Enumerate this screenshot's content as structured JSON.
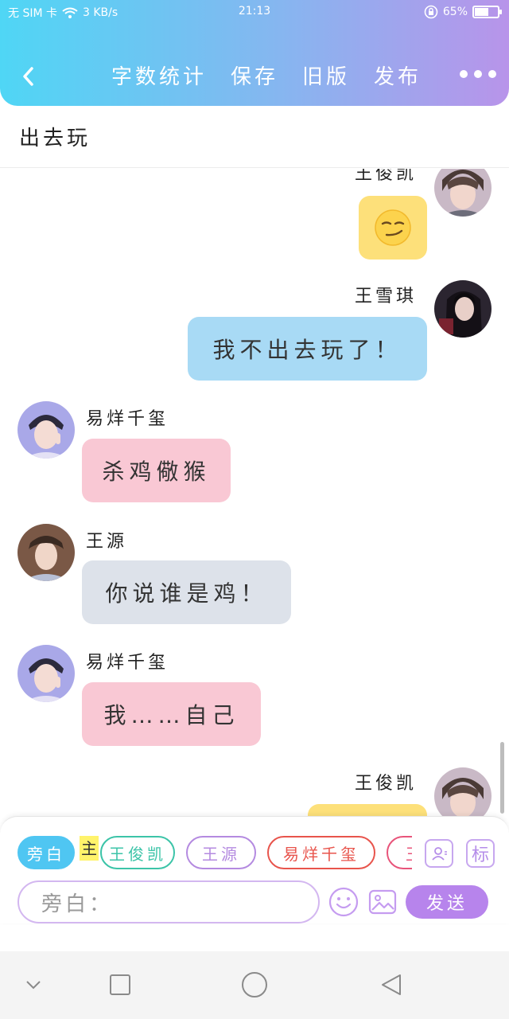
{
  "status_bar": {
    "carrier": "无 SIM 卡",
    "speed": "3 KB/s",
    "time": "21:13",
    "battery_text": "65%",
    "battery_level": 0.65
  },
  "nav": {
    "actions": [
      "字数统计",
      "保存",
      "旧版",
      "发布"
    ],
    "back_icon": "back-arrow-icon",
    "more_icon": "more-dots-icon"
  },
  "title": "出去玩",
  "messages": [
    {
      "sender": "王俊凯",
      "side": "right",
      "type": "emoji",
      "content": "smirk-emoji",
      "bubble_color": "#fde07a"
    },
    {
      "sender": "王雪琪",
      "side": "right",
      "type": "text",
      "content": "我不出去玩了！",
      "bubble_color": "#a8daf5"
    },
    {
      "sender": "易烊千玺",
      "side": "left",
      "type": "text",
      "content": "杀鸡儆猴",
      "bubble_color": "#f9c8d4"
    },
    {
      "sender": "王源",
      "side": "left",
      "type": "text",
      "content": "你说谁是鸡！",
      "bubble_color": "#dde2ea"
    },
    {
      "sender": "易烊千玺",
      "side": "left",
      "type": "text",
      "content": "我……自己",
      "bubble_color": "#f9c8d4"
    },
    {
      "sender": "王俊凯",
      "side": "right",
      "type": "text",
      "content": "",
      "bubble_color": "#fde07a"
    }
  ],
  "composer": {
    "chips": [
      {
        "label": "旁白",
        "selected": true,
        "color": "#4fc6f2"
      },
      {
        "label": "王俊凯",
        "selected": false,
        "color": "#3cc4a8",
        "badge": "主"
      },
      {
        "label": "王源",
        "selected": false,
        "color": "#b48ae0"
      },
      {
        "label": "易烊千玺",
        "selected": false,
        "color": "#e8544c"
      },
      {
        "label": "王",
        "selected": false,
        "color": "#e8547a"
      }
    ],
    "contact_icon": "contact-card-icon",
    "tag_label": "标",
    "input_prefix": "旁白：",
    "emoji_icon": "smile-icon",
    "image_icon": "image-icon",
    "send_label": "发送"
  },
  "system_nav": {
    "icons": [
      "chevron-down-icon",
      "square-icon",
      "circle-icon",
      "triangle-back-icon"
    ]
  }
}
